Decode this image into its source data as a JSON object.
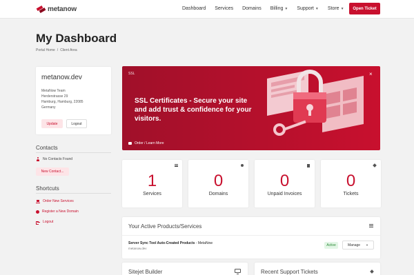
{
  "brand": {
    "name": "metanow",
    "accent": "#c8102e"
  },
  "nav": {
    "items": [
      {
        "label": "Dashboard",
        "dropdown": false
      },
      {
        "label": "Services",
        "dropdown": false
      },
      {
        "label": "Domains",
        "dropdown": false
      },
      {
        "label": "Billing",
        "dropdown": true
      },
      {
        "label": "Support",
        "dropdown": true
      },
      {
        "label": "Store",
        "dropdown": true
      }
    ],
    "cta": "Open Ticket"
  },
  "header": {
    "title": "My Dashboard",
    "breadcrumb": [
      "Portal Home",
      "Client Area"
    ]
  },
  "client": {
    "name": "metanow.dev",
    "address": [
      "MetaNow Team",
      "Herderstrasse 29",
      "Hamburg, Hamburg, 22085",
      "Germany"
    ],
    "update_label": "Update",
    "logout_label": "Logout"
  },
  "contacts": {
    "heading": "Contacts",
    "empty": "No Contacts Found",
    "new_label": "New Contact..."
  },
  "shortcuts": {
    "heading": "Shortcuts",
    "items": [
      {
        "label": "Order New Services",
        "icon": "cart-icon"
      },
      {
        "label": "Register a New Domain",
        "icon": "globe-icon"
      },
      {
        "label": "Logout",
        "icon": "logout-icon"
      }
    ]
  },
  "banner": {
    "label": "SSL",
    "headline": "SSL Certificates - Secure your site and add trust & confidence for your visitors.",
    "link": "Order / Learn More",
    "close": "×"
  },
  "stats": [
    {
      "value": "1",
      "label": "Services",
      "icon": "list-icon"
    },
    {
      "value": "0",
      "label": "Domains",
      "icon": "globe-icon"
    },
    {
      "value": "0",
      "label": "Unpaid Invoices",
      "icon": "invoice-icon"
    },
    {
      "value": "0",
      "label": "Tickets",
      "icon": "tag-icon"
    }
  ],
  "products": {
    "title": "Your Active Products/Services",
    "items": [
      {
        "name": "Server Sync Tool Auto-Created Products",
        "vendor": " - MetaNow",
        "domain": "metanow.dev",
        "status": "Active",
        "action": "Manage"
      }
    ]
  },
  "sitejet": {
    "title": "Sitejet Builder"
  },
  "tickets": {
    "title": "Recent Support Tickets"
  }
}
